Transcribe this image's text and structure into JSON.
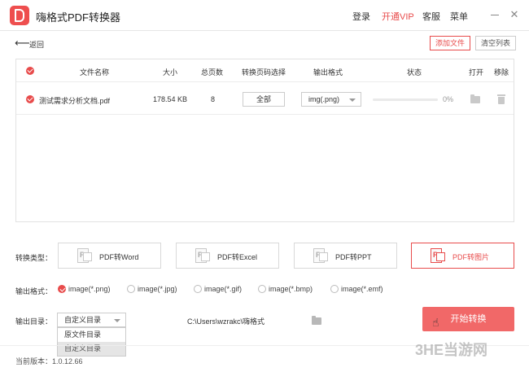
{
  "app": {
    "title": "嗨格式PDF转换器",
    "nav": {
      "login": "登录",
      "vip": "开通VIP",
      "service": "客服",
      "menu": "菜单"
    }
  },
  "toolbar": {
    "back_label": "返回",
    "add_file_label": "添加文件",
    "clear_list_label": "清空列表"
  },
  "table": {
    "columns": [
      "文件名称",
      "大小",
      "总页数",
      "转换页码选择",
      "输出格式",
      "状态",
      "打开",
      "移除"
    ],
    "rows": [
      {
        "name": "测试需求分析文档.pdf",
        "size": "178.54 KB",
        "pages": "8",
        "page_selection": "全部",
        "format": "img(.png)",
        "progress": 0,
        "status": "0%"
      }
    ]
  },
  "conversion": {
    "type_label": "转换类型：",
    "types": [
      "PDF转Word",
      "PDF转Excel",
      "PDF转PPT",
      "PDF转图片"
    ],
    "active_type": "PDF转图片",
    "format_label": "输出格式：",
    "formats": [
      "image(*.png)",
      "image(*.jpg)",
      "image(*.gif)",
      "image(*.bmp)",
      "image(*.emf)"
    ],
    "selected_format": "image(*.png)",
    "dir_label": "输出目录：",
    "dir_selected": "自定义目录",
    "dir_options": [
      "原文件目录",
      "自定义目录"
    ],
    "output_path": "C:\\Users\\wzrakc\\嗨格式",
    "start_label": "开始转换"
  },
  "footer": {
    "version": "当前版本：1.0.12.66"
  },
  "watermark": "3HE当游网",
  "colors": {
    "accent": "#e84b4b",
    "start_button": "#f16868"
  },
  "icons": [
    "app-logo-icon",
    "back-arrow-icon",
    "minimize-icon",
    "close-icon",
    "check-icon",
    "folder-icon",
    "trash-icon",
    "pdf-doc-icon",
    "chevron-down-icon",
    "cursor-hand-icon"
  ]
}
